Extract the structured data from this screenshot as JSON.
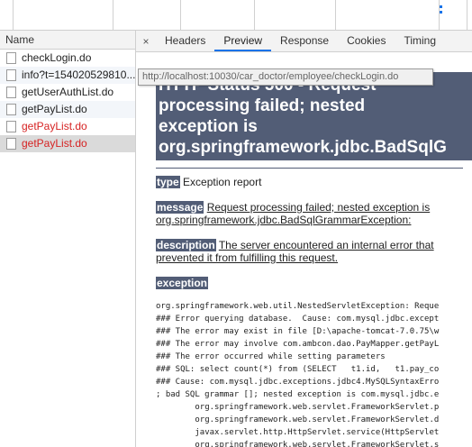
{
  "list": {
    "header": "Name",
    "rows": [
      "checkLogin.do",
      "info?t=154020529810...",
      "getUserAuthList.do",
      "getPayList.do",
      "getPayList.do",
      "getPayList.do"
    ]
  },
  "tabs": {
    "close": "×",
    "items": [
      "Headers",
      "Preview",
      "Response",
      "Cookies",
      "Timing"
    ],
    "active": "Preview"
  },
  "tooltip": "http://localhost:10030/car_doctor/employee/checkLogin.do",
  "preview": {
    "title_lines": [
      "HTTP Status 500 - Request",
      "processing failed; nested",
      "exception is",
      "org.springframework.jdbc.BadSqlG"
    ],
    "type_label": "type",
    "type_value": "Exception report",
    "message_label": "message",
    "message_value": "Request processing failed; nested exception is org.springframework.jdbc.BadSqlGrammarException:",
    "description_label": "description",
    "description_value": "The server encountered an internal error that prevented it from fulfilling this request.",
    "exception_label": "exception",
    "trace_lines": [
      "org.springframework.web.util.NestedServletException: Reque",
      "### Error querying database.  Cause: com.mysql.jdbc.except",
      "### The error may exist in file [D:\\apache-tomcat-7.0.75\\w",
      "### The error may involve com.ambcon.dao.PayMapper.getPayL",
      "### The error occurred while setting parameters",
      "### SQL: select count(*) from (SELECT   t1.id,   t1.pay_co",
      "### Cause: com.mysql.jdbc.exceptions.jdbc4.MySQLSyntaxErro",
      "; bad SQL grammar []; nested exception is com.mysql.jdbc.e",
      "\torg.springframework.web.servlet.FrameworkServlet.p",
      "\torg.springframework.web.servlet.FrameworkServlet.d",
      "\tjavax.servlet.http.HttpServlet.service(HttpServlet",
      "\torg.springframework.web.servlet.FrameworkServlet.s"
    ]
  },
  "colors": {
    "title_bg": "#525d76",
    "error_text": "#d62222",
    "active_tab": "#1a73e8"
  }
}
